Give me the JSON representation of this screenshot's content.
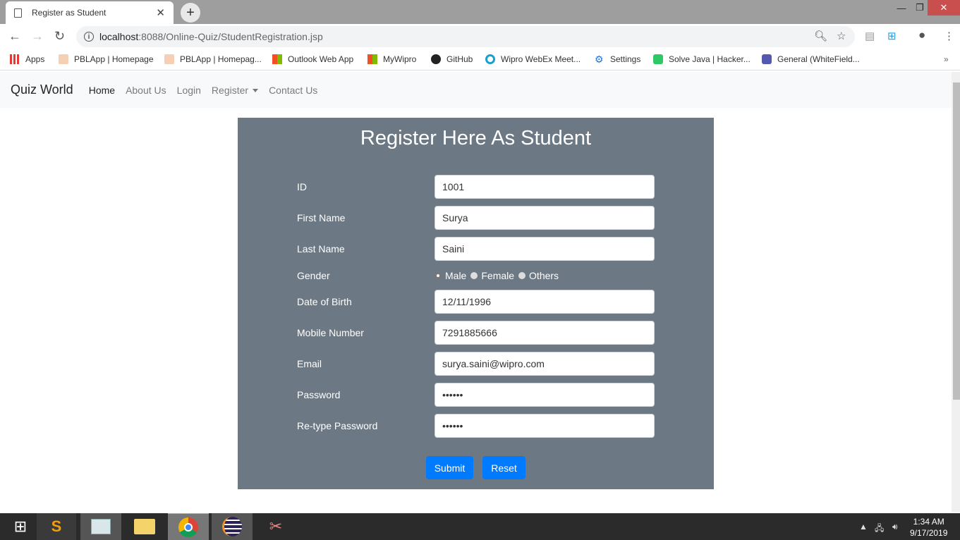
{
  "browser": {
    "tab_title": "Register as Student",
    "url_host": "localhost",
    "url_path": ":8088/Online-Quiz/StudentRegistration.jsp",
    "bookmarks": [
      {
        "label": "Apps",
        "icon": "apps-grid-icon"
      },
      {
        "label": "PBLApp | Homepage",
        "icon": "pbl-icon"
      },
      {
        "label": "PBLApp | Homepag...",
        "icon": "pbl-icon"
      },
      {
        "label": "Outlook Web App",
        "icon": "microsoft-icon"
      },
      {
        "label": "MyWipro",
        "icon": "microsoft-icon"
      },
      {
        "label": "GitHub",
        "icon": "github-icon"
      },
      {
        "label": "Wipro WebEx Meet...",
        "icon": "webex-icon"
      },
      {
        "label": "Settings",
        "icon": "gear-icon"
      },
      {
        "label": "Solve Java | Hacker...",
        "icon": "hackerrank-icon"
      },
      {
        "label": "General (WhiteField...",
        "icon": "teams-icon"
      }
    ],
    "more_bookmarks": "»"
  },
  "navbar": {
    "brand": "Quiz World",
    "links": [
      "Home",
      "About Us",
      "Login",
      "Register",
      "Contact Us"
    ]
  },
  "form": {
    "title": "Register Here As Student",
    "fields": {
      "id": {
        "label": "ID",
        "value": "1001"
      },
      "first_name": {
        "label": "First Name",
        "value": "Surya"
      },
      "last_name": {
        "label": "Last Name",
        "value": "Saini"
      },
      "gender": {
        "label": "Gender",
        "options": [
          "Male",
          "Female",
          "Others"
        ],
        "selected": "Male"
      },
      "dob": {
        "label": "Date of Birth",
        "value": "12/11/1996"
      },
      "mobile": {
        "label": "Mobile Number",
        "value": "7291885666"
      },
      "email": {
        "label": "Email",
        "value": "surya.saini@wipro.com"
      },
      "password": {
        "label": "Password",
        "value": "••••••"
      },
      "retype_password": {
        "label": "Re-type Password",
        "value": "••••••"
      }
    },
    "submit_label": "Submit",
    "reset_label": "Reset"
  },
  "taskbar": {
    "time": "1:34 AM",
    "date": "9/17/2019"
  },
  "colors": {
    "card_bg": "#6c7884",
    "button": "#007bff",
    "navbar_bg": "#f8f9fa"
  }
}
